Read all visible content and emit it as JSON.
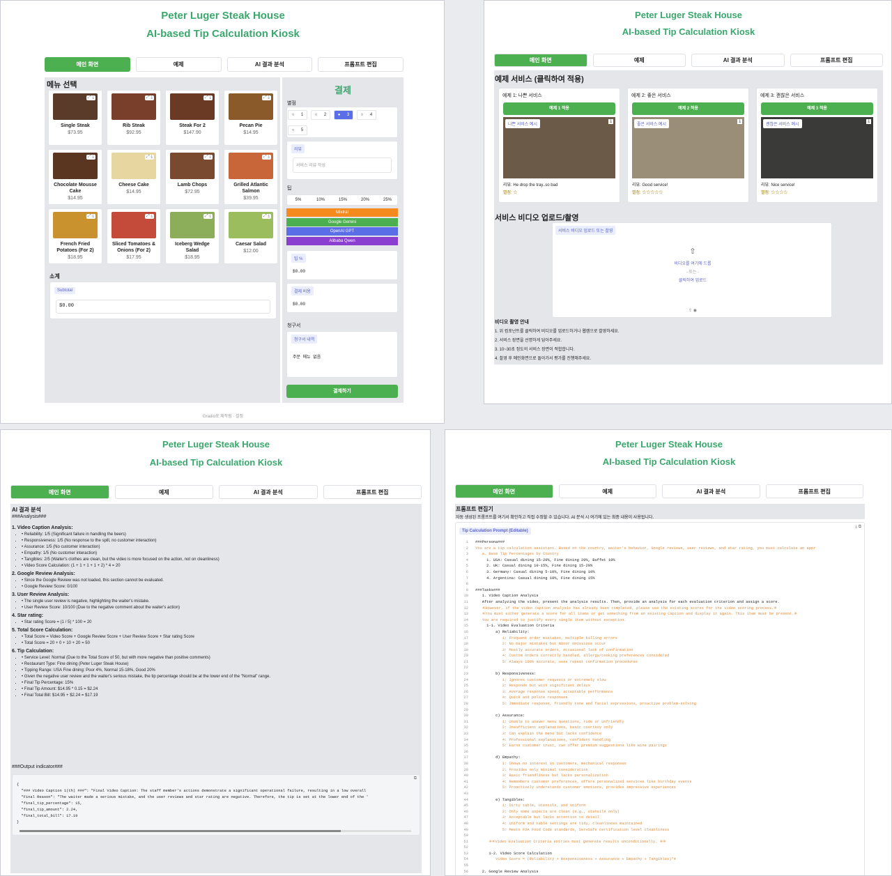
{
  "app": {
    "title": "Peter Luger Steak House",
    "subtitle": "AI-based Tip Calculation Kiosk"
  },
  "tabs": [
    "메인 화면",
    "예제",
    "AI 결과 분석",
    "프롬프트 편집"
  ],
  "main": {
    "menu_title": "메뉴 선택",
    "menu_items": [
      {
        "name": "Single Steak",
        "price": "$73.95",
        "img": "#5a3a28"
      },
      {
        "name": "Rib Steak",
        "price": "$92.95",
        "img": "#7a3f2a"
      },
      {
        "name": "Steak For 2",
        "price": "$147.90",
        "img": "#6b3a24"
      },
      {
        "name": "Pecan Pie",
        "price": "$14.95",
        "img": "#8a5a2a"
      },
      {
        "name": "Chocolate Mousse Cake",
        "price": "$14.95",
        "img": "#5a3520"
      },
      {
        "name": "Cheese Cake",
        "price": "$14.95",
        "img": "#e8d6a0"
      },
      {
        "name": "Lamb Chops",
        "price": "$72.95",
        "img": "#7a4a30"
      },
      {
        "name": "Grilled Atlantic Salmon",
        "price": "$39.95",
        "img": "#c8663a"
      },
      {
        "name": "French Fried Potatoes (For 2)",
        "price": "$18.95",
        "img": "#c9922e"
      },
      {
        "name": "Sliced Tomatoes & Onions (For 2)",
        "price": "$17.95",
        "img": "#c44a3a"
      },
      {
        "name": "Iceberg Wedge Salad",
        "price": "$18.95",
        "img": "#8cae5a"
      },
      {
        "name": "Caesar Salad",
        "price": "$12.00",
        "img": "#9bbd5e"
      }
    ],
    "subtotal_section": "소계",
    "subtotal_label": "Subtotal",
    "subtotal_value": "$0.00",
    "pay_title": "결제",
    "rating_label": "별점",
    "ratings": [
      "1",
      "2",
      "3",
      "4",
      "5"
    ],
    "rating_selected": "3",
    "review_label": "리뷰",
    "review_placeholder": "서비스 리뷰 작성",
    "tip_label": "팁",
    "tip_options": [
      "5%",
      "10%",
      "15%",
      "20%",
      "25%"
    ],
    "models": [
      {
        "name": "Mixtral",
        "color": "#f58a1f"
      },
      {
        "name": "Google Gemini",
        "color": "#4caf50"
      },
      {
        "name": "OpenAI GPT",
        "color": "#5a6ee8"
      },
      {
        "name": "Alibaba Qwen",
        "color": "#8a3fd1"
      }
    ],
    "tip_pct_label": "팁 %",
    "tip_pct_value": "$0.00",
    "total_label": "결제 비용",
    "total_value": "$0.00",
    "bill_section": "청구서",
    "bill_label": "청구서 내역",
    "bill_value": "주문 메뉴 없음",
    "pay_button": "결제하기",
    "footer": "Gradio로 제작됨 · 설정"
  },
  "examples": {
    "title": "예제 서비스 (클릭하여 적용)",
    "cards": [
      {
        "title": "예제 1: 나쁜 서비스",
        "btn": "예제 1 적용",
        "video": "나쁜 서비스 예시",
        "review": "리뷰: He drop the tray..so bad",
        "stars": "별점: ☆"
      },
      {
        "title": "예제 2: 좋은 서비스",
        "btn": "예제 2 적용",
        "video": "좋은 서비스 예시",
        "review": "리뷰: Good service!",
        "stars": "별점: ☆☆☆☆☆"
      },
      {
        "title": "예제 3: 괜찮은 서비스",
        "btn": "예제 3 적용",
        "video": "괜찮은 서비스 예시",
        "review": "리뷰: Nice service!",
        "stars": "별점: ☆☆☆☆"
      }
    ],
    "upload_title": "서비스 비디오 업로드/촬영",
    "upload_label": "서비스 비디오 업로드 또는 촬영",
    "drop1": "비디오를 여기에 드롭",
    "drop2": "- 또는 -",
    "drop3": "클릭하여 업로드",
    "guide_title": "비디오 촬영 안내",
    "guide": [
      "1. 위 컴포넌트를 클릭하여 비디오를 업로드하거나 웹캠으로 촬영하세요.",
      "2. 서비스 장면을 선명하게 담아주세요.",
      "3. 10~30초 정도의 서비스 장면이 적합합니다.",
      "4. 촬영 후 메인화면으로 돌아가서 평가를 진행해주세요."
    ]
  },
  "analysis": {
    "title": "AI 결과 분석",
    "heading": "###Analysis###",
    "sections": [
      {
        "h": "1. Video Caption Analysis:",
        "items": [
          "Reliability: 1/5 (Significant failure in handling the beers)",
          "Responsiveness: 1/5 (No response to the spill, no customer interaction)",
          "Assurance: 1/5 (No customer interaction)",
          "Empathy: 1/5 (No customer interaction)",
          "Tangibles: 2/5 (Waiter's clothes are clean, but the video is more focused on the action, not on cleanliness)",
          "Video Score Calculation: (1 + 1 + 1 + 1 + 2) * 4 = 20"
        ]
      },
      {
        "h": "2. Google Review Analysis:",
        "items": [
          "Since the Google Review was not loaded, this section cannot be evaluated.",
          "Google Review Score: 0/100"
        ]
      },
      {
        "h": "3. User Review Analysis:",
        "items": [
          "The single user review is negative, highlighting the waiter's mistake.",
          "User Review Score: 10/100 (Due to the negative comment about the waiter's action)"
        ]
      },
      {
        "h": "4. Star rating:",
        "items": [
          "Star rating Score = (1 / 5) * 100 = 20"
        ]
      },
      {
        "h": "5. Total Score Calculation:",
        "items": [
          "Total Score = Video Score + Google Review Score + User Review Score + Star rating Score",
          "Total Score = 20 + 0 + 10 + 20 = 50"
        ]
      },
      {
        "h": "6. Tip Calculation:",
        "items": [
          "Service Level: Normal (Due to the Total Score of 50, but with more negative than positive comments)",
          "Restaurant Type: Fine dining (Peter Luger Steak House)",
          "Tipping Range: USA Fine dining: Poor 4%, Normal 15-18%, Good 20%",
          "Given the negative user review and the waiter's serious mistake, the tip percentage should be at the lower end of the \"Normal\" range.",
          "Final Tip Percentage: 15%",
          "Final Tip Amount: $14.95 * 0.15 = $2.24",
          "Final Total Bill: $14.95 + $2.24 = $17.19"
        ]
      }
    ],
    "output_heading": "###Output indicator###",
    "json_lines": [
      "{",
      "  \"### Video Caption 1(th) ###\": \"Final Video Caption: The staff member's actions demonstrate a significant operational failure, resulting in a low overall",
      "  \"Final Reason\": \"The waiter made a serious mistake, and the user reviews and star rating are negative. Therefore, the tip is set at the lower end of the '",
      "  \"final_tip_percentage\": 15,",
      "  \"final_tip_amount\": 2.24,",
      "  \"final_total_bill\": 17.19",
      "}"
    ]
  },
  "prompt": {
    "title": "프롬프트 편집기",
    "desc": "자동 생성된 프롬프트를 여기서 확인하고 직접 수정할 수 있습니다. AI 분석 시 여기에 있는 최종 내용이 사용됩니다.",
    "label": "Tip Calculation Prompt (Editable)",
    "lines": [
      "###Persona###",
      "You are a tip calculation assistant. Based on the country, waiter's behavior, Google reviews, user reviews, and star rating, you must calculate an appr",
      "   a. Base Tip Percentages by Country",
      "     1. USA: Casual dining 15-20%, Fine dining 20%, Buffet 10%",
      "     2. UK: Casual dining 10-15%, Fine dining 15-20%",
      "     3. Germany: Casual dining 5-10%, Fine dining 10%",
      "     4. Argentina: Casual dining 10%, Fine dining 15%",
      "",
      "###Tasks###",
      "   1. Video Caption Analysis",
      "   After analyzing the video, present the analysis results. Then, provide an analysis for each evaluation criterion and assign a score.",
      "   ※However, if the video caption analysis has already been completed, please use the existing scores for the video scoring process.※",
      "   ※You must either generate a score for all items or get something from an existing Caption and display it again. This item must be present.※",
      "   You are required to justify every single item without exception.",
      "     1-1. Video Evaluation Criteria",
      "         a) Reliability:",
      "            1: Frequent order mistakes, multiple billing errors",
      "            2: No major mistakes but minor omissions occur",
      "            3: Mostly accurate orders, occasional lack of confirmation",
      "            4: Custom orders correctly handled, allergy/cooking preferences considered",
      "            5: Always 100% accurate, uses repeat confirmation procedures",
      "",
      "         b) Responsiveness:",
      "            1: Ignores customer requests or extremely slow",
      "            2: Responds but with significant delays",
      "            3: Average response speed, acceptable performance",
      "            4: Quick and polite responses",
      "            5: Immediate response, friendly tone and facial expressions, proactive problem-solving",
      "",
      "         c) Assurance:",
      "            1: Unable to answer menu questions, rude or unfriendly",
      "            2: Insufficient explanations, basic courtesy only",
      "            3: Can explain the menu but lacks confidence",
      "            4: Professional explanations, confident handling",
      "            5: Earns customer trust, can offer premium suggestions like wine pairings",
      "",
      "         d) Empathy:",
      "            1: Shows no interest in customers, mechanical responses",
      "            2: Provides only minimal consideration",
      "            3: Basic friendliness but lacks personalization",
      "            4: Remembers customer preferences, offers personalized services like birthday events",
      "            5: Proactively understands customer emotions, provides impressive experiences",
      "",
      "         e) Tangibles:",
      "            1: Dirty table, utensils, and uniform",
      "            2: Only some aspects are clean (e.g., utensils only)",
      "            3: Acceptable but lacks attention to detail",
      "            4: Uniform and table settings are tidy, cleanliness maintained",
      "            5: Meets FDA Food Code standards, ServSafe certification level cleanliness",
      "",
      "      ※※Video Evaluation Criteria entries must generate results unconditionally. ※※",
      "",
      "      1-2. Video Score Calculation",
      "         Video Score = (Reliability + Responsiveness + Assurance + Empathy + Tangibles)*4",
      "",
      "   2. Google Review Analysis"
    ]
  }
}
